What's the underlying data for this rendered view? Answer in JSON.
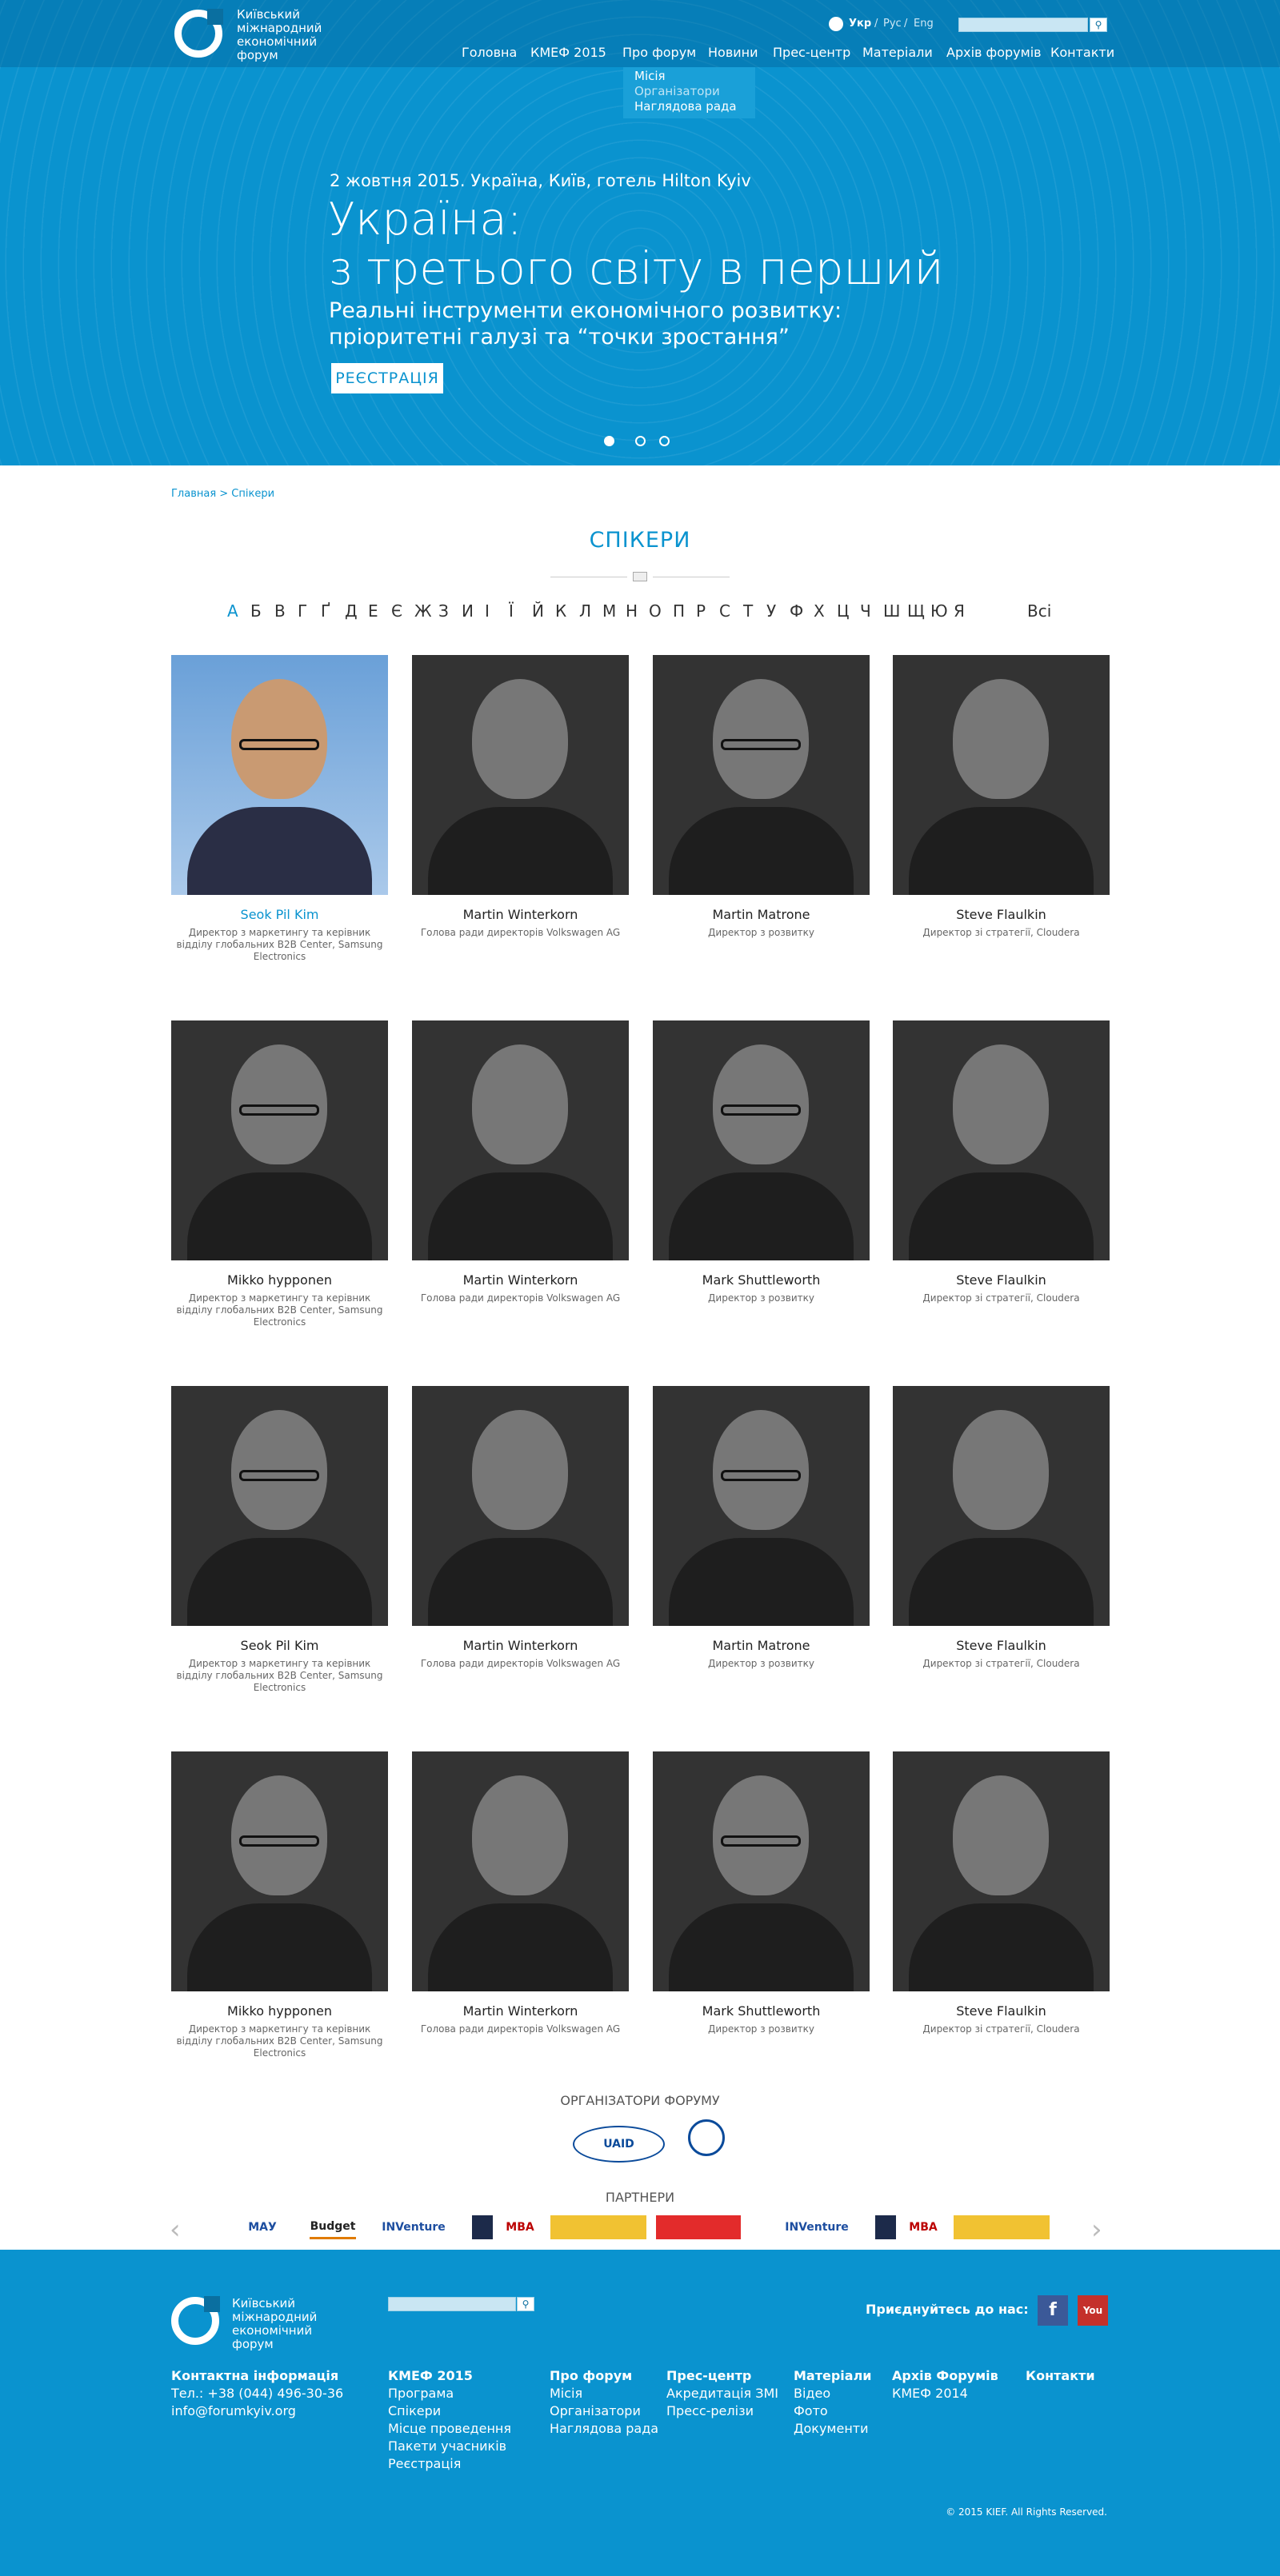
{
  "header": {
    "logo_lines": [
      "Київський",
      "міжнародний",
      "економічний",
      "форум"
    ],
    "lang": {
      "ukr": "Укр",
      "rus": "Рус",
      "eng": "Eng"
    },
    "nav": [
      "Головна",
      "КМЕФ 2015",
      "Про форум",
      "Новини",
      "Прес-центр",
      "Матеріали",
      "Архів форумів",
      "Контакти"
    ],
    "dropdown": [
      "Місія",
      "Організатори",
      "Наглядова рада"
    ]
  },
  "hero": {
    "date": "2 жовтня 2015. Україна, Київ, готель Hilton Kyiv",
    "title_line1": "Україна:",
    "title_line2": "з третього світу в перший",
    "subtitle_line1": "Реальні інструменти економічного розвитку:",
    "subtitle_line2": "пріоритетні галузі та “точки зростання”",
    "register": "РЕЄСТРАЦІЯ",
    "slides_active": 1
  },
  "breadcrumb": "Главная > Спікери",
  "section_title": "СПІКЕРИ",
  "alphabet": [
    "А",
    "Б",
    "В",
    "Г",
    "Ґ",
    "Д",
    "Е",
    "Є",
    "Ж",
    "З",
    "И",
    "І",
    "Ї",
    "Й",
    "К",
    "Л",
    "М",
    "Н",
    "О",
    "П",
    "Р",
    "С",
    "Т",
    "У",
    "Ф",
    "Х",
    "Ц",
    "Ч",
    "Ш",
    "Щ",
    "Ю",
    "Я"
  ],
  "alphabet_all": "Всі",
  "speakers": [
    {
      "name": "Seok Pil Kim",
      "role": "Директор з маркетингу та керівник відділу глобальних B2B Center, Samsung Electronics"
    },
    {
      "name": "Martin Winterkorn",
      "role": "Голова ради директорів Volkswagen AG"
    },
    {
      "name": "Martin Matrone",
      "role": "Директор з розвитку"
    },
    {
      "name": "Steve Flaulkin",
      "role": "Директор зі стратегії, Cloudera"
    },
    {
      "name": "Mikko hypponen",
      "role": "Директор з маркетингу та керівник відділу глобальних B2B Center, Samsung Electronics"
    },
    {
      "name": "Martin Winterkorn",
      "role": "Голова ради директорів Volkswagen AG"
    },
    {
      "name": "Mark Shuttleworth",
      "role": "Директор з розвитку"
    },
    {
      "name": "Steve Flaulkin",
      "role": "Директор зі стратегії, Cloudera"
    },
    {
      "name": "Seok Pil Kim",
      "role": "Директор з маркетингу та керівник відділу глобальних B2B Center, Samsung Electronics"
    },
    {
      "name": "Martin Winterkorn",
      "role": "Голова ради директорів Volkswagen AG"
    },
    {
      "name": "Martin Matrone",
      "role": "Директор з розвитку"
    },
    {
      "name": "Steve Flaulkin",
      "role": "Директор зі стратегії, Cloudera"
    },
    {
      "name": "Mikko hypponen",
      "role": "Директор з маркетингу та керівник відділу глобальних B2B Center, Samsung Electronics"
    },
    {
      "name": "Martin Winterkorn",
      "role": "Голова ради директорів Volkswagen AG"
    },
    {
      "name": "Mark Shuttleworth",
      "role": "Директор з розвитку"
    },
    {
      "name": "Steve Flaulkin",
      "role": "Директор зі стратегії, Cloudera"
    }
  ],
  "organizers_title": "ОРГАНІЗАТОРИ ФОРУМУ",
  "organizers": [
    "UAID"
  ],
  "partners_title": "ПАРТНЕРИ",
  "partners": [
    "МАУ",
    "Budget",
    "INVenture",
    "MBA",
    "INVenture",
    "MBA"
  ],
  "footer": {
    "join": "Приєднуйтесь до нас:",
    "contact_head": "Контактна інформація",
    "phone": "Тел.: +38 (044) 496-30-36",
    "email": "info@forumkyiv.org",
    "col_kmef": {
      "head": "КМЕФ 2015",
      "links": [
        "Програма",
        "Спікери",
        "Місце проведення",
        "Пакети учасників",
        "Реєстрація"
      ]
    },
    "col_about": {
      "head": "Про форум",
      "links": [
        "Місія",
        "Організатори",
        "Наглядова рада"
      ]
    },
    "col_press": {
      "head": "Прес-центр",
      "links": [
        "Акредитація ЗМІ",
        "Пресс-релізи"
      ]
    },
    "col_materials": {
      "head": "Матеріали",
      "links": [
        "Відео",
        "Фото",
        "Документи"
      ]
    },
    "col_archive": {
      "head": "Архів Форумів",
      "links": [
        "КМЕФ 2014"
      ]
    },
    "col_contacts": {
      "head": "Контакти"
    },
    "copyright": "© 2015 KIEF. All Rights Reserved.",
    "facebook": "f",
    "youtube": "You"
  },
  "colors": {
    "brand": "#0a93cf",
    "link": "#0a93cf",
    "footer_bg": "#0a93cf"
  }
}
